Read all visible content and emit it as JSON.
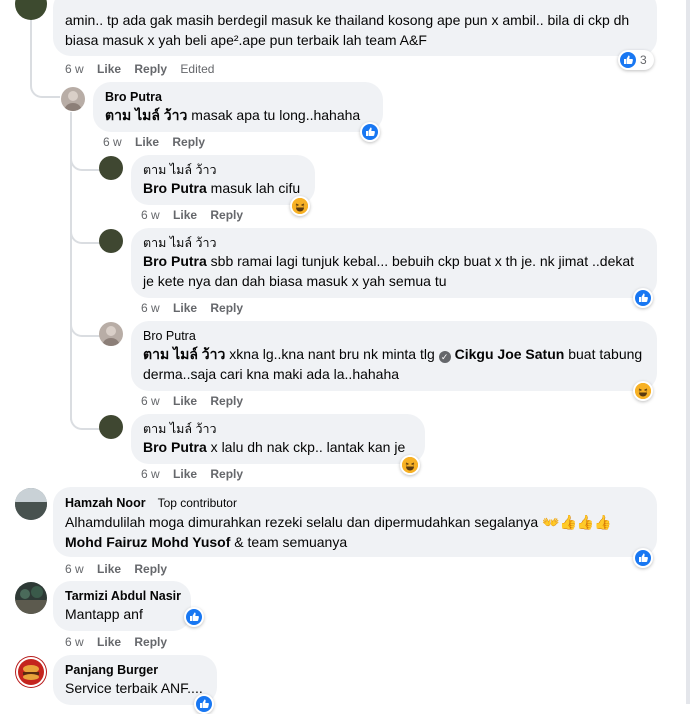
{
  "comments": [
    {
      "id": "c0",
      "text": "amin.. tp ada gak masih berdegil masuk ke thailand kosong ape pun x ambil.. bila di ckp dh biasa masuk x yah beli ape².ape pun terbaik lah team A&F",
      "time": "6 w",
      "like": "Like",
      "reply": "Reply",
      "edited": "Edited",
      "reaction": "like",
      "reaction_count": "3"
    },
    {
      "id": "c1",
      "author": "Bro Putra",
      "mention": "ตาม ไมล์ ว้าว",
      "text": " masak apa tu long..hahaha",
      "time": "6 w",
      "like": "Like",
      "reply": "Reply",
      "reaction": "like"
    },
    {
      "id": "c2",
      "author": "ตาม ไมล์ ว้าว",
      "mention": "Bro Putra",
      "text": " masuk lah cifu",
      "time": "6 w",
      "like": "Like",
      "reply": "Reply",
      "reaction": "haha"
    },
    {
      "id": "c3",
      "author": "ตาม ไมล์ ว้าว",
      "mention": "Bro Putra",
      "text": " sbb ramai lagi tunjuk kebal... bebuih ckp buat x th je. nk jimat ..dekat je kete nya dan dah biasa masuk x yah semua tu",
      "time": "6 w",
      "like": "Like",
      "reply": "Reply",
      "reaction": "like"
    },
    {
      "id": "c4",
      "author": "Bro Putra",
      "mention": "ตาม ไมล์ ว้าว",
      "text": " xkna lg..kna nant bru nk minta tlg ",
      "mention2": "Cikgu Joe Satun",
      "text2": " buat tabung derma..saja cari kna maki ada la..hahaha",
      "time": "6 w",
      "like": "Like",
      "reply": "Reply",
      "reaction": "haha"
    },
    {
      "id": "c5",
      "author": "ตาม ไมล์ ว้าว",
      "mention": "Bro Putra",
      "text": " x lalu dh nak ckp.. lantak kan je",
      "time": "6 w",
      "like": "Like",
      "reply": "Reply",
      "reaction": "haha"
    },
    {
      "id": "c6",
      "author": "Hamzah Noor",
      "badge": "Top contributor",
      "text": "Alhamdulilah moga dimurahkan rezeki selalu dan dipermudahkan segalanya 👐👍👍👍",
      "mention": "Mohd Fairuz Mohd Yusof",
      "text2": " & team semuanya",
      "time": "6 w",
      "like": "Like",
      "reply": "Reply",
      "reaction": "like"
    },
    {
      "id": "c7",
      "author": "Tarmizi Abdul Nasir",
      "text": "Mantapp anf",
      "time": "6 w",
      "like": "Like",
      "reply": "Reply",
      "reaction": "like"
    },
    {
      "id": "c8",
      "author": "Panjang Burger",
      "text": "Service terbaik ANF....",
      "reaction": "like"
    }
  ],
  "icons": {
    "like": "thumbs-up-icon",
    "haha": "haha-emoji-icon",
    "verified": "verified-badge-icon"
  },
  "colors": {
    "bubble": "#f0f2f5",
    "like": "#1877f2",
    "haha": "#f7b125",
    "meta": "#65676b"
  }
}
